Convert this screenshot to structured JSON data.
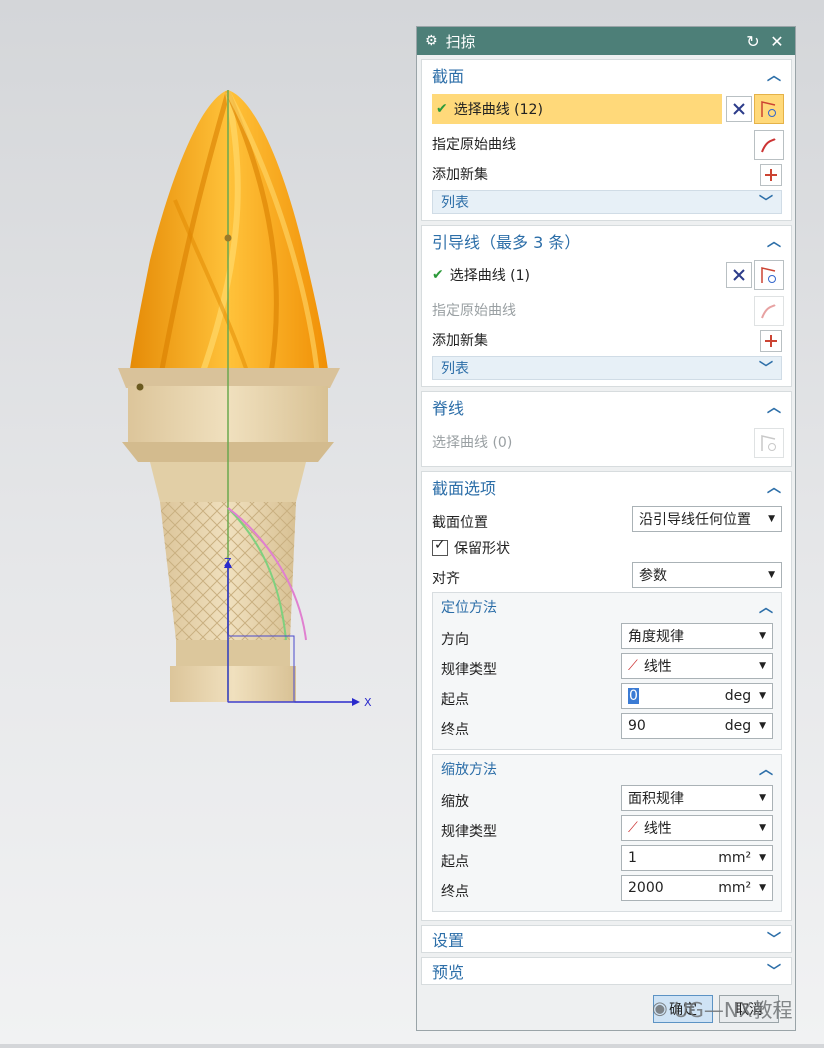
{
  "dialog": {
    "title": "扫掠",
    "icons": {
      "title": "gear-icon",
      "reset": "reset-icon",
      "close": "close-icon"
    }
  },
  "section": {
    "header": "截面",
    "select_curve": "选择曲线 (12)",
    "specify_original": "指定原始曲线",
    "add_new_set": "添加新集",
    "list": "列表"
  },
  "guide": {
    "header": "引导线（最多 3 条）",
    "select_curve": "选择曲线 (1)",
    "specify_original": "指定原始曲线",
    "add_new_set": "添加新集",
    "list": "列表"
  },
  "spine": {
    "header": "脊线",
    "select_curve": "选择曲线 (0)"
  },
  "section_options": {
    "header": "截面选项",
    "position_label": "截面位置",
    "position_value": "沿引导线任何位置",
    "preserve_shape": "保留形状",
    "preserve_checked": true,
    "align_label": "对齐",
    "align_value": "参数",
    "orientation": {
      "header": "定位方法",
      "direction_label": "方向",
      "direction_value": "角度规律",
      "law_type_label": "规律类型",
      "law_type_value": "线性",
      "start_label": "起点",
      "start_value": "0",
      "start_unit": "deg",
      "end_label": "终点",
      "end_value": "90",
      "end_unit": "deg"
    },
    "scaling": {
      "header": "缩放方法",
      "scale_label": "缩放",
      "scale_value": "面积规律",
      "law_type_label": "规律类型",
      "law_type_value": "线性",
      "start_label": "起点",
      "start_value": "1",
      "start_unit": "mm²",
      "end_label": "终点",
      "end_value": "2000",
      "end_unit": "mm²"
    }
  },
  "settings": {
    "header": "设置"
  },
  "preview": {
    "header": "预览"
  },
  "buttons": {
    "ok": "确定",
    "cancel": "取消"
  },
  "watermark": "UG—NX教程",
  "viewport": {
    "axis_z": "Z",
    "axis_x": "X"
  },
  "colors": {
    "accent": "#2c6ea8",
    "titlebar": "#4d7f78",
    "selected": "#ffd97a",
    "flame": "#f5a31a",
    "cone": "#e8d4a8"
  }
}
